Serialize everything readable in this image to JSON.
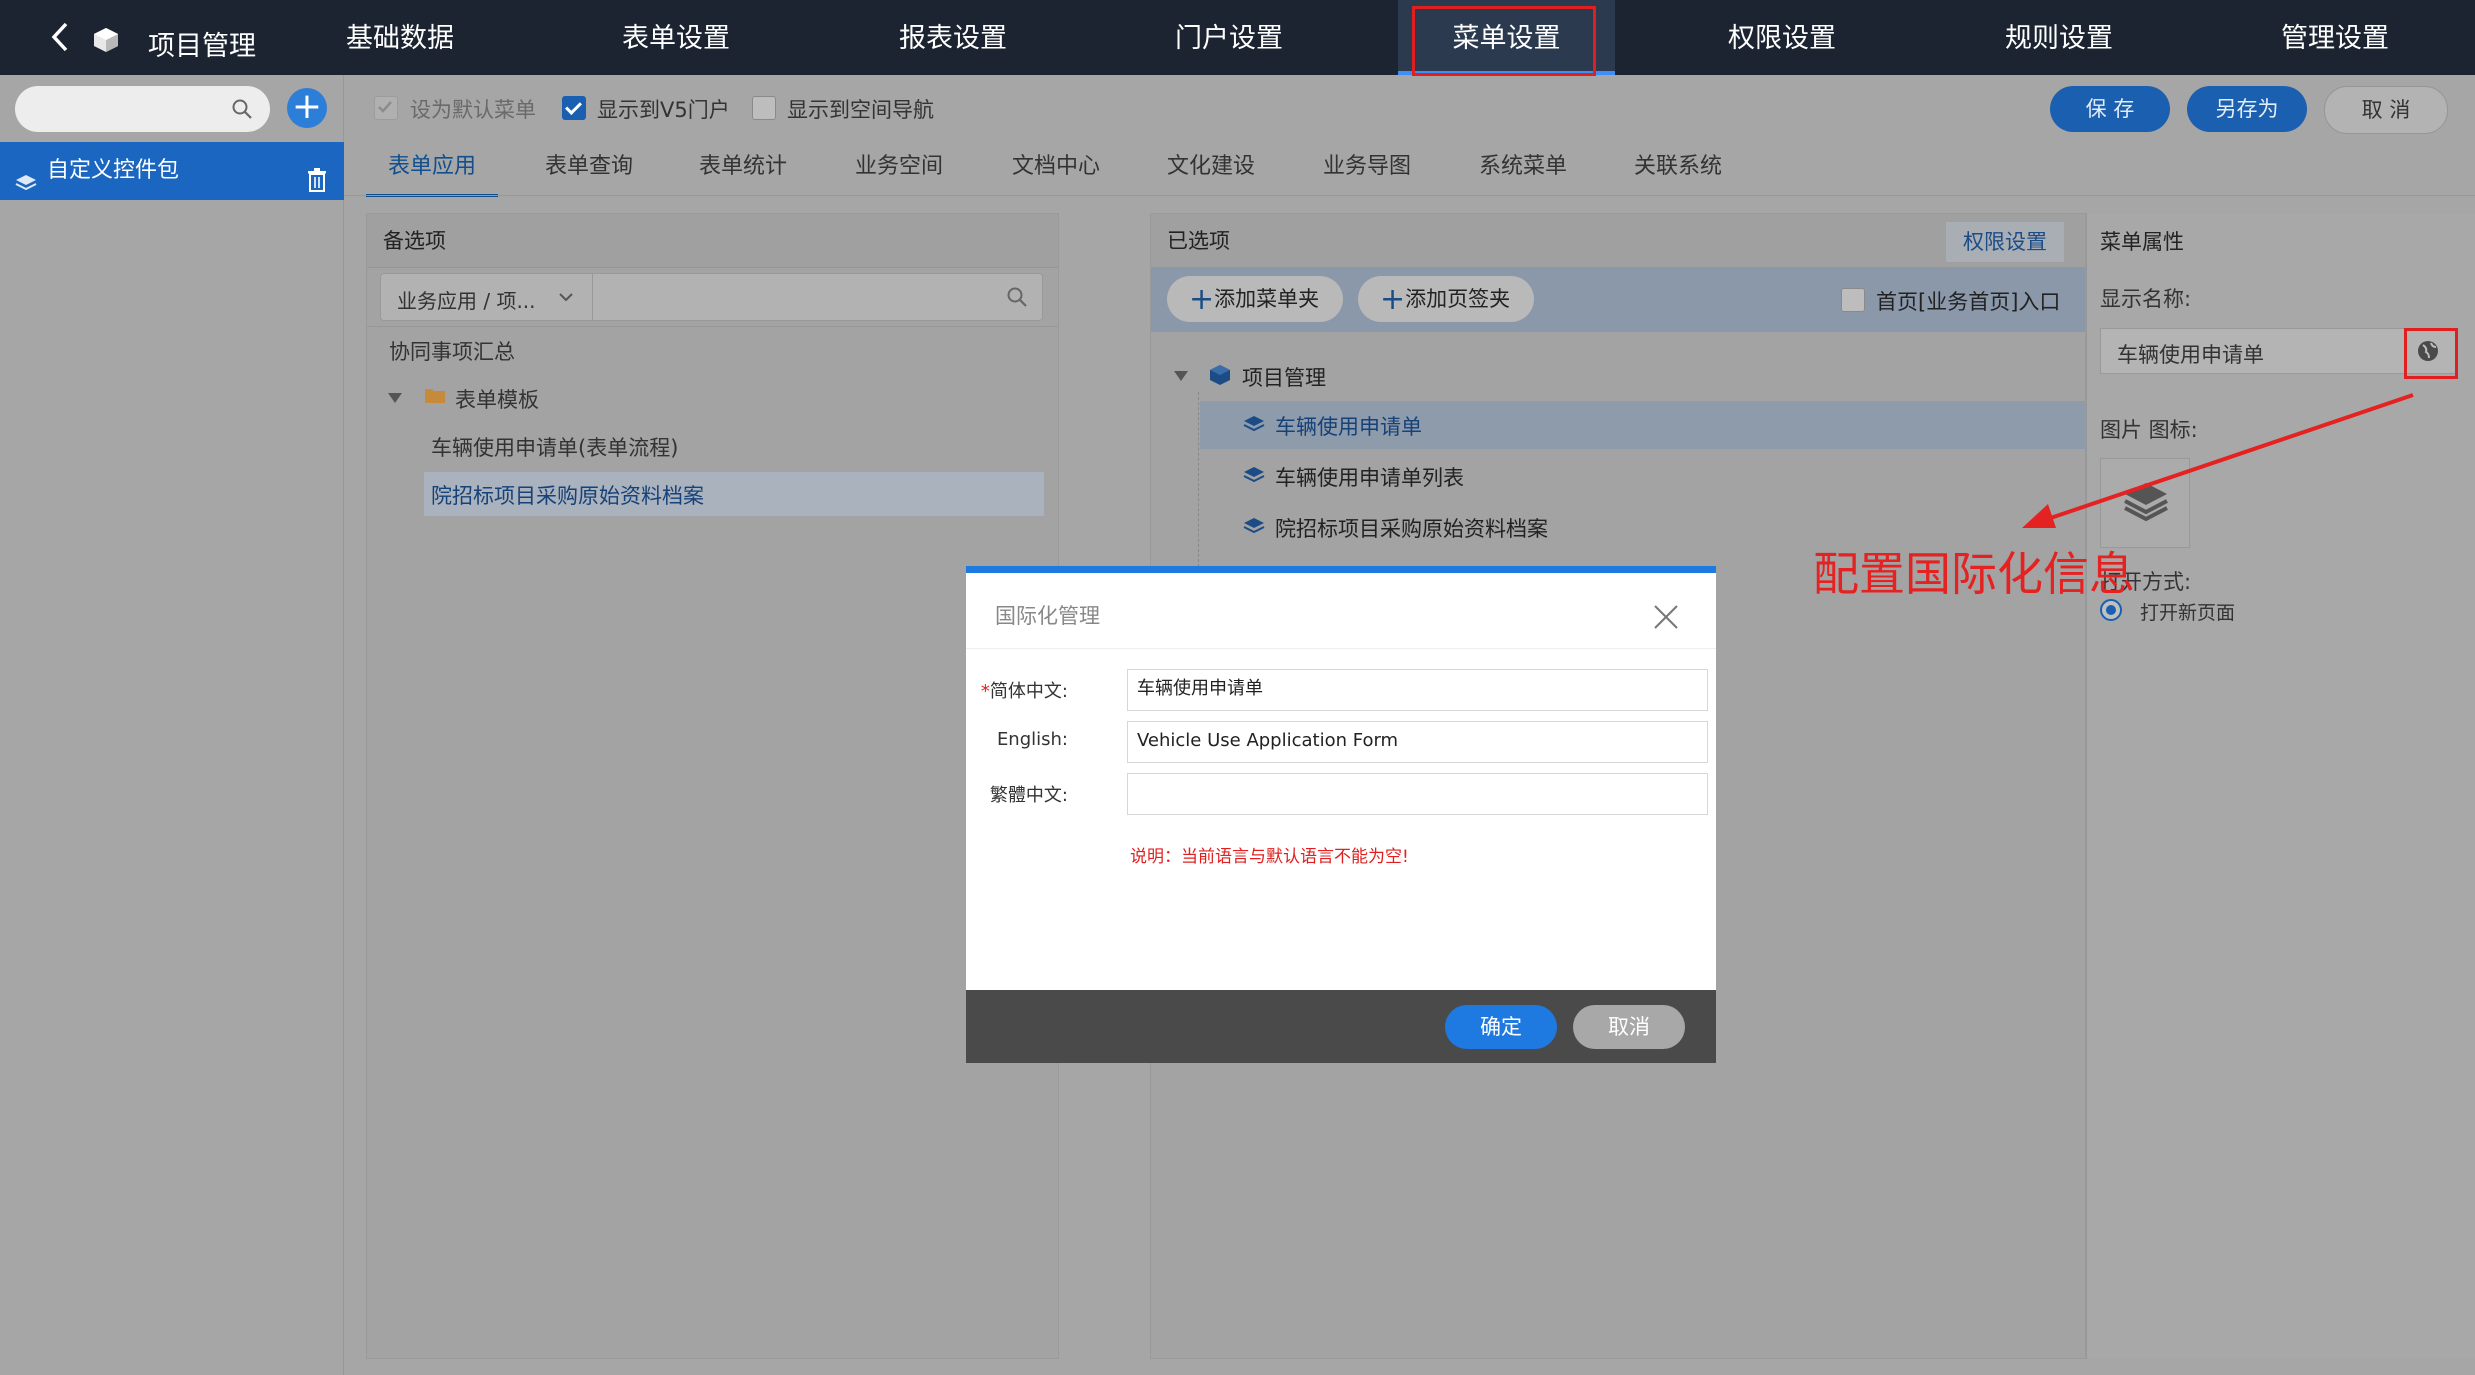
{
  "app": {
    "title": "项目管理"
  },
  "nav": [
    {
      "label": "基础数据"
    },
    {
      "label": "表单设置"
    },
    {
      "label": "报表设置"
    },
    {
      "label": "门户设置"
    },
    {
      "label": "菜单设置",
      "active": true
    },
    {
      "label": "权限设置"
    },
    {
      "label": "规则设置"
    },
    {
      "label": "管理设置"
    }
  ],
  "sidebar": {
    "search_placeholder": "",
    "selected_item": "自定义控件包"
  },
  "toolbar": {
    "options": [
      {
        "label": "设为默认菜单",
        "checked": false,
        "disabled": true
      },
      {
        "label": "显示到V5门户",
        "checked": true,
        "disabled": false
      },
      {
        "label": "显示到空间导航",
        "checked": false,
        "disabled": false
      }
    ],
    "save_label": "保 存",
    "save_as_label": "另存为",
    "cancel_label": "取 消"
  },
  "tabs": [
    {
      "label": "表单应用",
      "active": true
    },
    {
      "label": "表单查询"
    },
    {
      "label": "表单统计"
    },
    {
      "label": "业务空间"
    },
    {
      "label": "文档中心"
    },
    {
      "label": "文化建设"
    },
    {
      "label": "业务导图"
    },
    {
      "label": "系统菜单"
    },
    {
      "label": "关联系统"
    }
  ],
  "candidates": {
    "title": "备选项",
    "filter_select": "业务应用 / 项...",
    "items": {
      "summary": "协同事项汇总",
      "folder": "表单模板",
      "children": [
        "车辆使用申请单(表单流程)",
        "院招标项目采购原始资料档案"
      ]
    }
  },
  "selected": {
    "title": "已选项",
    "permission_link": "权限设置",
    "add_folder": "添加菜单夹",
    "add_tab": "添加页签夹",
    "homepage_entry": "首页[业务首页]入口",
    "root": "项目管理",
    "children": [
      "车辆使用申请单",
      "车辆使用申请单列表",
      "院招标项目采购原始资料档案"
    ]
  },
  "properties": {
    "title": "菜单属性",
    "display_name_label": "显示名称:",
    "display_name_value": "车辆使用申请单",
    "icon_label": "图片 图标:",
    "open_mode_label": "打开方式:",
    "open_mode_value": "打开新页面"
  },
  "annotation": "配置国际化信息",
  "dialog": {
    "title": "国际化管理",
    "fields": [
      {
        "label": "简体中文:",
        "value": "车辆使用申请单",
        "required": true
      },
      {
        "label": "English:",
        "value": "Vehicle Use Application Form",
        "required": false
      },
      {
        "label": "繁體中文:",
        "value": "",
        "required": false
      }
    ],
    "note": "说明：当前语言与默认语言不能为空!",
    "ok_label": "确定",
    "cancel_label": "取消"
  },
  "colors": {
    "accent": "#1e7ae0",
    "topbar": "#1b24 30",
    "annotation": "#e52222"
  }
}
